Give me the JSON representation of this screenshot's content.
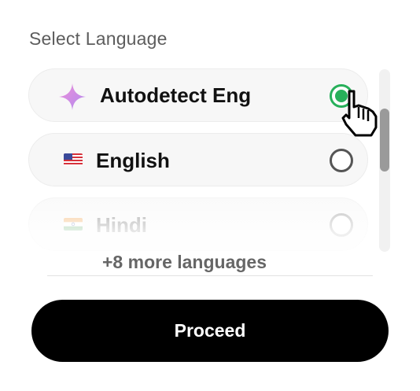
{
  "heading": "Select Language",
  "languages": [
    {
      "label": "Autodetect Eng",
      "icon": "sparkle-icon",
      "selected": true
    },
    {
      "label": "English",
      "icon": "us-flag-icon",
      "selected": false
    },
    {
      "label": "Hindi",
      "icon": "india-flag-icon",
      "selected": false
    }
  ],
  "more_languages": "+8 more languages",
  "proceed_label": "Proceed",
  "colors": {
    "accent_selected": "#27b05a",
    "button_bg": "#000000",
    "button_text": "#ffffff",
    "sparkle_pink": "#ee8fd8",
    "sparkle_purple": "#b08af0"
  }
}
